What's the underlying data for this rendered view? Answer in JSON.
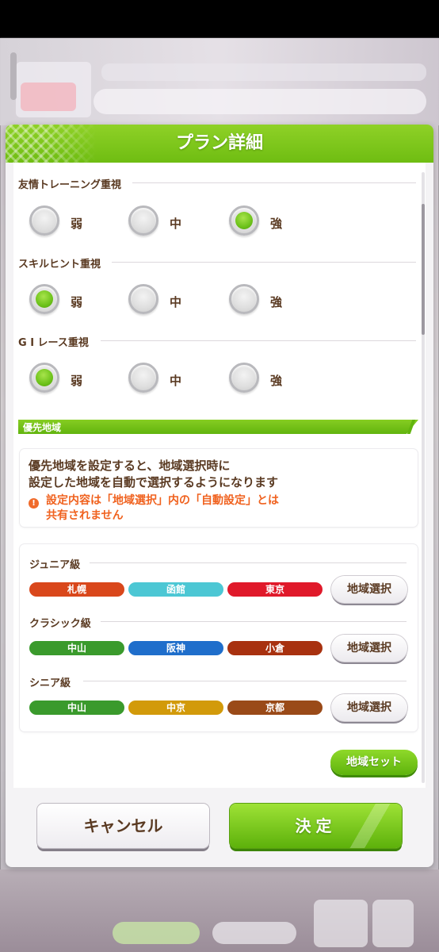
{
  "modal": {
    "title": "プラン詳細",
    "sections": [
      {
        "label": "友情トレーニング重視",
        "options": [
          "弱",
          "中",
          "強"
        ],
        "selected_index": 2
      },
      {
        "label": "スキルヒント重視",
        "options": [
          "弱",
          "中",
          "強"
        ],
        "selected_index": 0
      },
      {
        "label": "G I レース重視",
        "options": [
          "弱",
          "中",
          "強"
        ],
        "selected_index": 0
      }
    ],
    "priority": {
      "header": "優先地域",
      "info_line1": "優先地域を設定すると、地域選択時に",
      "info_line2": "設定した地域を自動で選択するようになります",
      "warn_icon": "!",
      "warn_line1": "設定内容は「地域選択」内の「自動設定」とは",
      "warn_line2": "共有されません"
    },
    "grades": [
      {
        "label": "ジュニア級",
        "regions": [
          {
            "name": "札幌",
            "color": "#d9471b"
          },
          {
            "name": "函館",
            "color": "#4cc7d4"
          },
          {
            "name": "東京",
            "color": "#e0192a"
          }
        ],
        "select_label": "地域選択"
      },
      {
        "label": "クラシック級",
        "regions": [
          {
            "name": "中山",
            "color": "#3a9a2c"
          },
          {
            "name": "阪神",
            "color": "#1f6ecb"
          },
          {
            "name": "小倉",
            "color": "#a8310f"
          }
        ],
        "select_label": "地域選択"
      },
      {
        "label": "シニア級",
        "regions": [
          {
            "name": "中山",
            "color": "#3a9a2c"
          },
          {
            "name": "中京",
            "color": "#d29a0a"
          },
          {
            "name": "京都",
            "color": "#9a4a18"
          }
        ],
        "select_label": "地域選択"
      }
    ],
    "region_set_label": "地域セット",
    "cancel_label": "キャンセル",
    "ok_label": "決定"
  },
  "colors": {
    "accent_green": "#6fbd12",
    "text_brown": "#5a3a22",
    "warning_orange": "#f0621f"
  }
}
